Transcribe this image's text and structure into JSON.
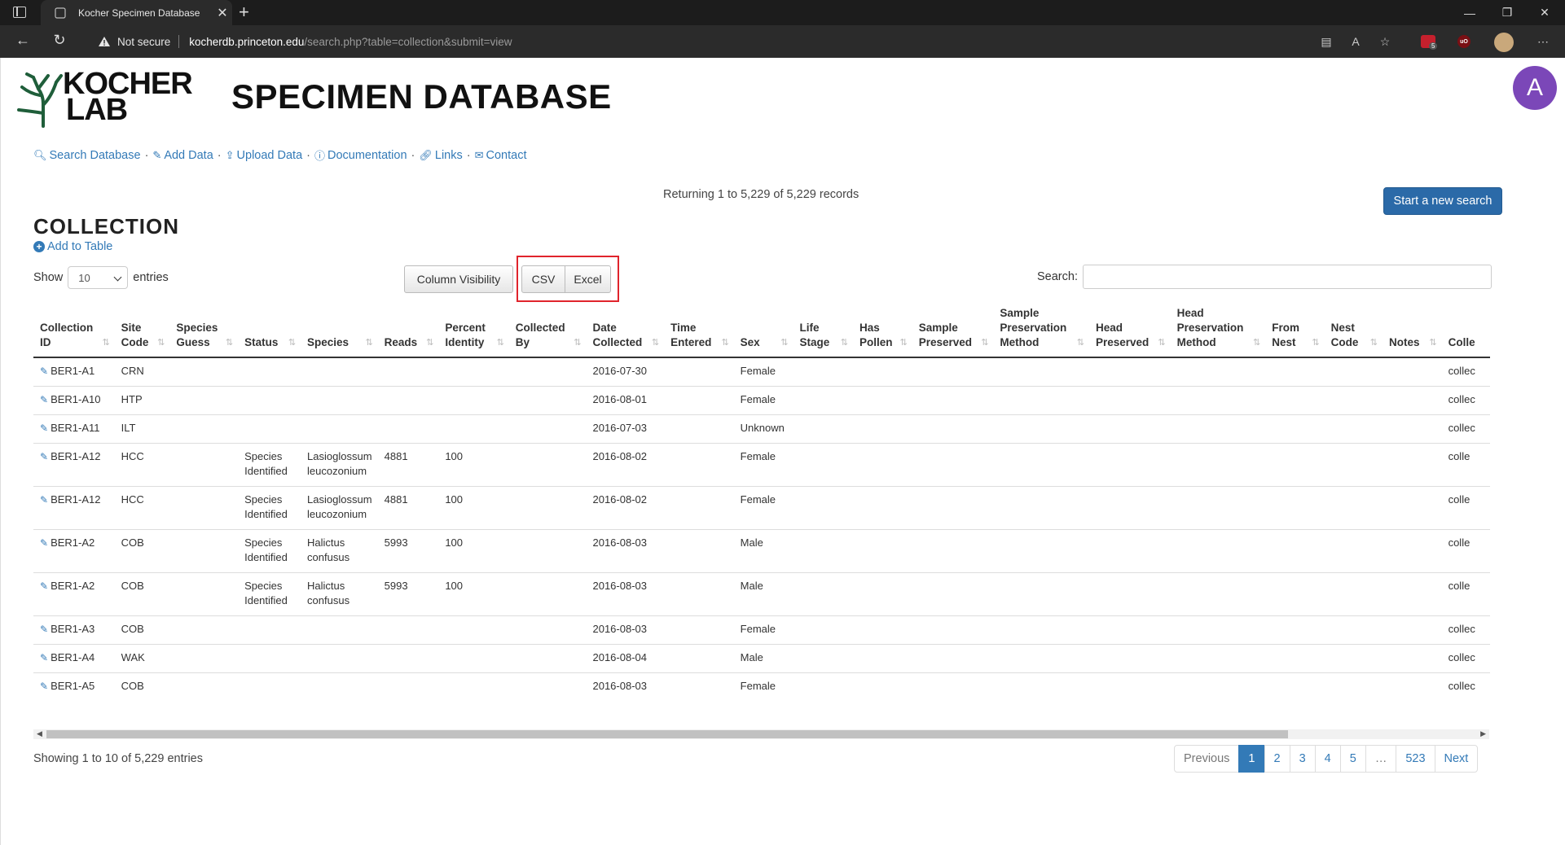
{
  "browser": {
    "tab_title": "Kocher Specimen Database",
    "not_secure": "Not secure",
    "url_host": "kocherdb.princeton.edu",
    "url_path": "/search.php?table=collection&submit=view",
    "ext_badge": "5",
    "ublock_label": "uO"
  },
  "header": {
    "logo_line1": "KOCHER",
    "logo_line2": "LAB",
    "title": "SPECIMEN DATABASE",
    "avatar_letter": "A"
  },
  "nav": [
    {
      "icon": "search-icon",
      "label": "Search Database"
    },
    {
      "icon": "edit-icon",
      "label": "Add Data"
    },
    {
      "icon": "upload-icon",
      "label": "Upload Data"
    },
    {
      "icon": "info-icon",
      "label": "Documentation"
    },
    {
      "icon": "link-icon",
      "label": "Links"
    },
    {
      "icon": "envelope-icon",
      "label": "Contact"
    }
  ],
  "results": {
    "returning": "Returning 1 to 5,229 of 5,229 records",
    "new_search": "Start a new search",
    "section_title": "COLLECTION",
    "add_to_table": "Add to Table",
    "show_label": "Show",
    "entries_label": "entries",
    "page_size": "10",
    "column_visibility": "Column Visibility",
    "csv": "CSV",
    "excel": "Excel",
    "search_label": "Search:",
    "search_value": ""
  },
  "table": {
    "columns": [
      [
        "Collection",
        "ID"
      ],
      [
        "Site",
        "Code"
      ],
      [
        "Species",
        "Guess"
      ],
      [
        "Status"
      ],
      [
        "Species"
      ],
      [
        "Reads"
      ],
      [
        "Percent",
        "Identity"
      ],
      [
        "Collected",
        "By"
      ],
      [
        "Date",
        "Collected"
      ],
      [
        "Time",
        "Entered"
      ],
      [
        "Sex"
      ],
      [
        "Life",
        "Stage"
      ],
      [
        "Has",
        "Pollen"
      ],
      [
        "Sample",
        "Preserved"
      ],
      [
        "Sample",
        "Preservation",
        "Method"
      ],
      [
        "Head",
        "Preserved"
      ],
      [
        "Head",
        "Preservation",
        "Method"
      ],
      [
        "From",
        "Nest"
      ],
      [
        "Nest",
        "Code"
      ],
      [
        "Notes"
      ],
      [
        "Colle"
      ]
    ],
    "rows": [
      [
        "BER1-A1",
        "CRN",
        "",
        "",
        "",
        "",
        "",
        "",
        "2016-07-30",
        "",
        "Female",
        "",
        "",
        "",
        "",
        "",
        "",
        "",
        "",
        "",
        "collec"
      ],
      [
        "BER1-A10",
        "HTP",
        "",
        "",
        "",
        "",
        "",
        "",
        "2016-08-01",
        "",
        "Female",
        "",
        "",
        "",
        "",
        "",
        "",
        "",
        "",
        "",
        "collec"
      ],
      [
        "BER1-A11",
        "ILT",
        "",
        "",
        "",
        "",
        "",
        "",
        "2016-07-03",
        "",
        "Unknown",
        "",
        "",
        "",
        "",
        "",
        "",
        "",
        "",
        "",
        "collec"
      ],
      [
        "BER1-A12",
        "HCC",
        "",
        "Species Identified",
        "Lasioglossum leucozonium",
        "4881",
        "100",
        "",
        "2016-08-02",
        "",
        "Female",
        "",
        "",
        "",
        "",
        "",
        "",
        "",
        "",
        "",
        "colle"
      ],
      [
        "BER1-A12",
        "HCC",
        "",
        "Species Identified",
        "Lasioglossum leucozonium",
        "4881",
        "100",
        "",
        "2016-08-02",
        "",
        "Female",
        "",
        "",
        "",
        "",
        "",
        "",
        "",
        "",
        "",
        "colle"
      ],
      [
        "BER1-A2",
        "COB",
        "",
        "Species Identified",
        "Halictus confusus",
        "5993",
        "100",
        "",
        "2016-08-03",
        "",
        "Male",
        "",
        "",
        "",
        "",
        "",
        "",
        "",
        "",
        "",
        "colle"
      ],
      [
        "BER1-A2",
        "COB",
        "",
        "Species Identified",
        "Halictus confusus",
        "5993",
        "100",
        "",
        "2016-08-03",
        "",
        "Male",
        "",
        "",
        "",
        "",
        "",
        "",
        "",
        "",
        "",
        "colle"
      ],
      [
        "BER1-A3",
        "COB",
        "",
        "",
        "",
        "",
        "",
        "",
        "2016-08-03",
        "",
        "Female",
        "",
        "",
        "",
        "",
        "",
        "",
        "",
        "",
        "",
        "collec"
      ],
      [
        "BER1-A4",
        "WAK",
        "",
        "",
        "",
        "",
        "",
        "",
        "2016-08-04",
        "",
        "Male",
        "",
        "",
        "",
        "",
        "",
        "",
        "",
        "",
        "",
        "collec"
      ],
      [
        "BER1-A5",
        "COB",
        "",
        "",
        "",
        "",
        "",
        "",
        "2016-08-03",
        "",
        "Female",
        "",
        "",
        "",
        "",
        "",
        "",
        "",
        "",
        "",
        "collec"
      ]
    ]
  },
  "footer": {
    "showing": "Showing 1 to 10 of 5,229 entries",
    "pagination": [
      "Previous",
      "1",
      "2",
      "3",
      "4",
      "5",
      "…",
      "523",
      "Next"
    ],
    "active_page": "1"
  },
  "colors": {
    "link": "#337ab7",
    "primary_button": "#2b6aa8",
    "avatar": "#7b47b8",
    "highlight_box": "#e0242c",
    "logo_green": "#1f5e3a"
  }
}
